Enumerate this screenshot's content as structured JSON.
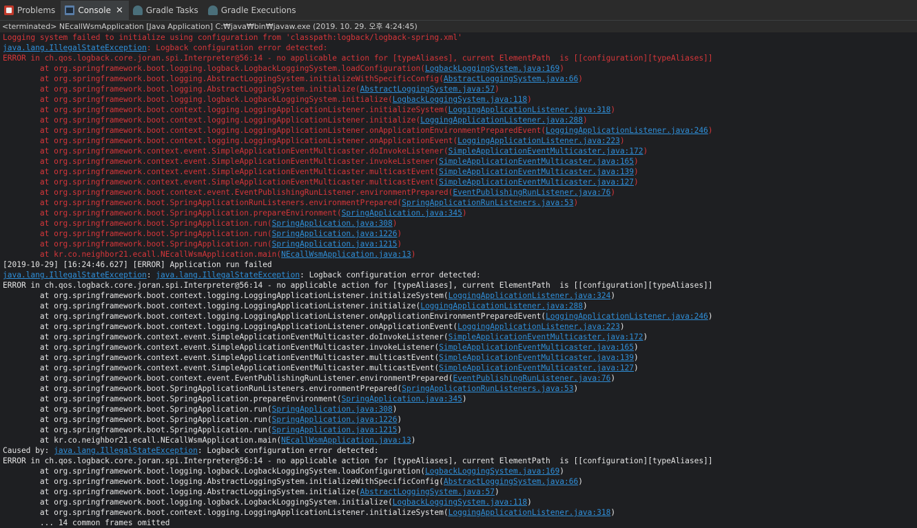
{
  "tabs": [
    {
      "name": "tab-problems",
      "icon": "problems-icon",
      "label": "Problems"
    },
    {
      "name": "tab-console",
      "icon": "console-icon",
      "label": "Console",
      "active": true
    },
    {
      "name": "tab-gradle-tasks",
      "icon": "gradle-tasks-icon",
      "label": "Gradle Tasks"
    },
    {
      "name": "tab-gradle-executions",
      "icon": "gradle-executions-icon",
      "label": "Gradle Executions"
    }
  ],
  "close_glyph": "✕",
  "status": "<terminated> NEcallWsmApplication [Java Application] C:₩java₩bin₩javaw.exe (2019. 10. 29. 오후 4:24:45)",
  "colors": {
    "error": "#d7363a",
    "normal": "#e6e6e6",
    "link": "#2f8fd9"
  },
  "lines": [
    {
      "style": "err",
      "parts": [
        {
          "text": "Logging system failed to initialize using configuration from 'classpath:logback/logback-spring.xml'"
        }
      ]
    },
    {
      "style": "err",
      "parts": [
        {
          "text": "java.lang.IllegalStateException",
          "link": true
        },
        {
          "text": ": Logback configuration error detected: "
        }
      ]
    },
    {
      "style": "err",
      "parts": [
        {
          "text": "ERROR in ch.qos.logback.core.joran.spi.Interpreter@56:14 - no applicable action for [typeAliases], current ElementPath  is [[configuration][typeAliases]]"
        }
      ]
    },
    {
      "style": "err",
      "parts": [
        {
          "text": "\tat org.springframework.boot.logging.logback.LogbackLoggingSystem.loadConfiguration("
        },
        {
          "text": "LogbackLoggingSystem.java:169",
          "link": true
        },
        {
          "text": ")"
        }
      ]
    },
    {
      "style": "err",
      "parts": [
        {
          "text": "\tat org.springframework.boot.logging.AbstractLoggingSystem.initializeWithSpecificConfig("
        },
        {
          "text": "AbstractLoggingSystem.java:66",
          "link": true
        },
        {
          "text": ")"
        }
      ]
    },
    {
      "style": "err",
      "parts": [
        {
          "text": "\tat org.springframework.boot.logging.AbstractLoggingSystem.initialize("
        },
        {
          "text": "AbstractLoggingSystem.java:57",
          "link": true
        },
        {
          "text": ")"
        }
      ]
    },
    {
      "style": "err",
      "parts": [
        {
          "text": "\tat org.springframework.boot.logging.logback.LogbackLoggingSystem.initialize("
        },
        {
          "text": "LogbackLoggingSystem.java:118",
          "link": true
        },
        {
          "text": ")"
        }
      ]
    },
    {
      "style": "err",
      "parts": [
        {
          "text": "\tat org.springframework.boot.context.logging.LoggingApplicationListener.initializeSystem("
        },
        {
          "text": "LoggingApplicationListener.java:318",
          "link": true
        },
        {
          "text": ")"
        }
      ]
    },
    {
      "style": "err",
      "parts": [
        {
          "text": "\tat org.springframework.boot.context.logging.LoggingApplicationListener.initialize("
        },
        {
          "text": "LoggingApplicationListener.java:288",
          "link": true
        },
        {
          "text": ")"
        }
      ]
    },
    {
      "style": "err",
      "parts": [
        {
          "text": "\tat org.springframework.boot.context.logging.LoggingApplicationListener.onApplicationEnvironmentPreparedEvent("
        },
        {
          "text": "LoggingApplicationListener.java:246",
          "link": true
        },
        {
          "text": ")"
        }
      ]
    },
    {
      "style": "err",
      "parts": [
        {
          "text": "\tat org.springframework.boot.context.logging.LoggingApplicationListener.onApplicationEvent("
        },
        {
          "text": "LoggingApplicationListener.java:223",
          "link": true
        },
        {
          "text": ")"
        }
      ]
    },
    {
      "style": "err",
      "parts": [
        {
          "text": "\tat org.springframework.context.event.SimpleApplicationEventMulticaster.doInvokeListener("
        },
        {
          "text": "SimpleApplicationEventMulticaster.java:172",
          "link": true
        },
        {
          "text": ")"
        }
      ]
    },
    {
      "style": "err",
      "parts": [
        {
          "text": "\tat org.springframework.context.event.SimpleApplicationEventMulticaster.invokeListener("
        },
        {
          "text": "SimpleApplicationEventMulticaster.java:165",
          "link": true
        },
        {
          "text": ")"
        }
      ]
    },
    {
      "style": "err",
      "parts": [
        {
          "text": "\tat org.springframework.context.event.SimpleApplicationEventMulticaster.multicastEvent("
        },
        {
          "text": "SimpleApplicationEventMulticaster.java:139",
          "link": true
        },
        {
          "text": ")"
        }
      ]
    },
    {
      "style": "err",
      "parts": [
        {
          "text": "\tat org.springframework.context.event.SimpleApplicationEventMulticaster.multicastEvent("
        },
        {
          "text": "SimpleApplicationEventMulticaster.java:127",
          "link": true
        },
        {
          "text": ")"
        }
      ]
    },
    {
      "style": "err",
      "parts": [
        {
          "text": "\tat org.springframework.boot.context.event.EventPublishingRunListener.environmentPrepared("
        },
        {
          "text": "EventPublishingRunListener.java:76",
          "link": true
        },
        {
          "text": ")"
        }
      ]
    },
    {
      "style": "err",
      "parts": [
        {
          "text": "\tat org.springframework.boot.SpringApplicationRunListeners.environmentPrepared("
        },
        {
          "text": "SpringApplicationRunListeners.java:53",
          "link": true
        },
        {
          "text": ")"
        }
      ]
    },
    {
      "style": "err",
      "parts": [
        {
          "text": "\tat org.springframework.boot.SpringApplication.prepareEnvironment("
        },
        {
          "text": "SpringApplication.java:345",
          "link": true
        },
        {
          "text": ")"
        }
      ]
    },
    {
      "style": "err",
      "parts": [
        {
          "text": "\tat org.springframework.boot.SpringApplication.run("
        },
        {
          "text": "SpringApplication.java:308",
          "link": true
        },
        {
          "text": ")"
        }
      ]
    },
    {
      "style": "err",
      "parts": [
        {
          "text": "\tat org.springframework.boot.SpringApplication.run("
        },
        {
          "text": "SpringApplication.java:1226",
          "link": true
        },
        {
          "text": ")"
        }
      ]
    },
    {
      "style": "err",
      "parts": [
        {
          "text": "\tat org.springframework.boot.SpringApplication.run("
        },
        {
          "text": "SpringApplication.java:1215",
          "link": true
        },
        {
          "text": ")"
        }
      ]
    },
    {
      "style": "err",
      "parts": [
        {
          "text": "\tat kr.co.neighbor21.ecall.NEcallWsmApplication.main("
        },
        {
          "text": "NEcallWsmApplication.java:13",
          "link": true
        },
        {
          "text": ")"
        }
      ]
    },
    {
      "style": "norm",
      "parts": [
        {
          "text": "[2019-10-29] [16:24:46.627] [ERROR] Application run failed"
        }
      ]
    },
    {
      "style": "norm",
      "parts": [
        {
          "text": "java.lang.IllegalStateException",
          "link": true
        },
        {
          "text": ": "
        },
        {
          "text": "java.lang.IllegalStateException",
          "link": true
        },
        {
          "text": ": Logback configuration error detected: "
        }
      ]
    },
    {
      "style": "norm",
      "parts": [
        {
          "text": "ERROR in ch.qos.logback.core.joran.spi.Interpreter@56:14 - no applicable action for [typeAliases], current ElementPath  is [[configuration][typeAliases]]"
        }
      ]
    },
    {
      "style": "norm",
      "parts": [
        {
          "text": "\tat org.springframework.boot.context.logging.LoggingApplicationListener.initializeSystem("
        },
        {
          "text": "LoggingApplicationListener.java:324",
          "link": true
        },
        {
          "text": ")"
        }
      ]
    },
    {
      "style": "norm",
      "parts": [
        {
          "text": "\tat org.springframework.boot.context.logging.LoggingApplicationListener.initialize("
        },
        {
          "text": "LoggingApplicationListener.java:288",
          "link": true
        },
        {
          "text": ")"
        }
      ]
    },
    {
      "style": "norm",
      "parts": [
        {
          "text": "\tat org.springframework.boot.context.logging.LoggingApplicationListener.onApplicationEnvironmentPreparedEvent("
        },
        {
          "text": "LoggingApplicationListener.java:246",
          "link": true
        },
        {
          "text": ")"
        }
      ]
    },
    {
      "style": "norm",
      "parts": [
        {
          "text": "\tat org.springframework.boot.context.logging.LoggingApplicationListener.onApplicationEvent("
        },
        {
          "text": "LoggingApplicationListener.java:223",
          "link": true
        },
        {
          "text": ")"
        }
      ]
    },
    {
      "style": "norm",
      "parts": [
        {
          "text": "\tat org.springframework.context.event.SimpleApplicationEventMulticaster.doInvokeListener("
        },
        {
          "text": "SimpleApplicationEventMulticaster.java:172",
          "link": true
        },
        {
          "text": ")"
        }
      ]
    },
    {
      "style": "norm",
      "parts": [
        {
          "text": "\tat org.springframework.context.event.SimpleApplicationEventMulticaster.invokeListener("
        },
        {
          "text": "SimpleApplicationEventMulticaster.java:165",
          "link": true
        },
        {
          "text": ")"
        }
      ]
    },
    {
      "style": "norm",
      "parts": [
        {
          "text": "\tat org.springframework.context.event.SimpleApplicationEventMulticaster.multicastEvent("
        },
        {
          "text": "SimpleApplicationEventMulticaster.java:139",
          "link": true
        },
        {
          "text": ")"
        }
      ]
    },
    {
      "style": "norm",
      "parts": [
        {
          "text": "\tat org.springframework.context.event.SimpleApplicationEventMulticaster.multicastEvent("
        },
        {
          "text": "SimpleApplicationEventMulticaster.java:127",
          "link": true
        },
        {
          "text": ")"
        }
      ]
    },
    {
      "style": "norm",
      "parts": [
        {
          "text": "\tat org.springframework.boot.context.event.EventPublishingRunListener.environmentPrepared("
        },
        {
          "text": "EventPublishingRunListener.java:76",
          "link": true
        },
        {
          "text": ")"
        }
      ]
    },
    {
      "style": "norm",
      "parts": [
        {
          "text": "\tat org.springframework.boot.SpringApplicationRunListeners.environmentPrepared("
        },
        {
          "text": "SpringApplicationRunListeners.java:53",
          "link": true
        },
        {
          "text": ")"
        }
      ]
    },
    {
      "style": "norm",
      "parts": [
        {
          "text": "\tat org.springframework.boot.SpringApplication.prepareEnvironment("
        },
        {
          "text": "SpringApplication.java:345",
          "link": true
        },
        {
          "text": ")"
        }
      ]
    },
    {
      "style": "norm",
      "parts": [
        {
          "text": "\tat org.springframework.boot.SpringApplication.run("
        },
        {
          "text": "SpringApplication.java:308",
          "link": true
        },
        {
          "text": ")"
        }
      ]
    },
    {
      "style": "norm",
      "parts": [
        {
          "text": "\tat org.springframework.boot.SpringApplication.run("
        },
        {
          "text": "SpringApplication.java:1226",
          "link": true
        },
        {
          "text": ")"
        }
      ]
    },
    {
      "style": "norm",
      "parts": [
        {
          "text": "\tat org.springframework.boot.SpringApplication.run("
        },
        {
          "text": "SpringApplication.java:1215",
          "link": true
        },
        {
          "text": ")"
        }
      ]
    },
    {
      "style": "norm",
      "parts": [
        {
          "text": "\tat kr.co.neighbor21.ecall.NEcallWsmApplication.main("
        },
        {
          "text": "NEcallWsmApplication.java:13",
          "link": true
        },
        {
          "text": ")"
        }
      ]
    },
    {
      "style": "norm",
      "parts": [
        {
          "text": "Caused by: "
        },
        {
          "text": "java.lang.IllegalStateException",
          "link": true
        },
        {
          "text": ": Logback configuration error detected: "
        }
      ]
    },
    {
      "style": "norm",
      "parts": [
        {
          "text": "ERROR in ch.qos.logback.core.joran.spi.Interpreter@56:14 - no applicable action for [typeAliases], current ElementPath  is [[configuration][typeAliases]]"
        }
      ]
    },
    {
      "style": "norm",
      "parts": [
        {
          "text": "\tat org.springframework.boot.logging.logback.LogbackLoggingSystem.loadConfiguration("
        },
        {
          "text": "LogbackLoggingSystem.java:169",
          "link": true
        },
        {
          "text": ")"
        }
      ]
    },
    {
      "style": "norm",
      "parts": [
        {
          "text": "\tat org.springframework.boot.logging.AbstractLoggingSystem.initializeWithSpecificConfig("
        },
        {
          "text": "AbstractLoggingSystem.java:66",
          "link": true
        },
        {
          "text": ")"
        }
      ]
    },
    {
      "style": "norm",
      "parts": [
        {
          "text": "\tat org.springframework.boot.logging.AbstractLoggingSystem.initialize("
        },
        {
          "text": "AbstractLoggingSystem.java:57",
          "link": true
        },
        {
          "text": ")"
        }
      ]
    },
    {
      "style": "norm",
      "parts": [
        {
          "text": "\tat org.springframework.boot.logging.logback.LogbackLoggingSystem.initialize("
        },
        {
          "text": "LogbackLoggingSystem.java:118",
          "link": true
        },
        {
          "text": ")"
        }
      ]
    },
    {
      "style": "norm",
      "parts": [
        {
          "text": "\tat org.springframework.boot.context.logging.LoggingApplicationListener.initializeSystem("
        },
        {
          "text": "LoggingApplicationListener.java:318",
          "link": true
        },
        {
          "text": ")"
        }
      ]
    },
    {
      "style": "norm",
      "parts": [
        {
          "text": "\t... 14 common frames omitted"
        }
      ]
    }
  ]
}
